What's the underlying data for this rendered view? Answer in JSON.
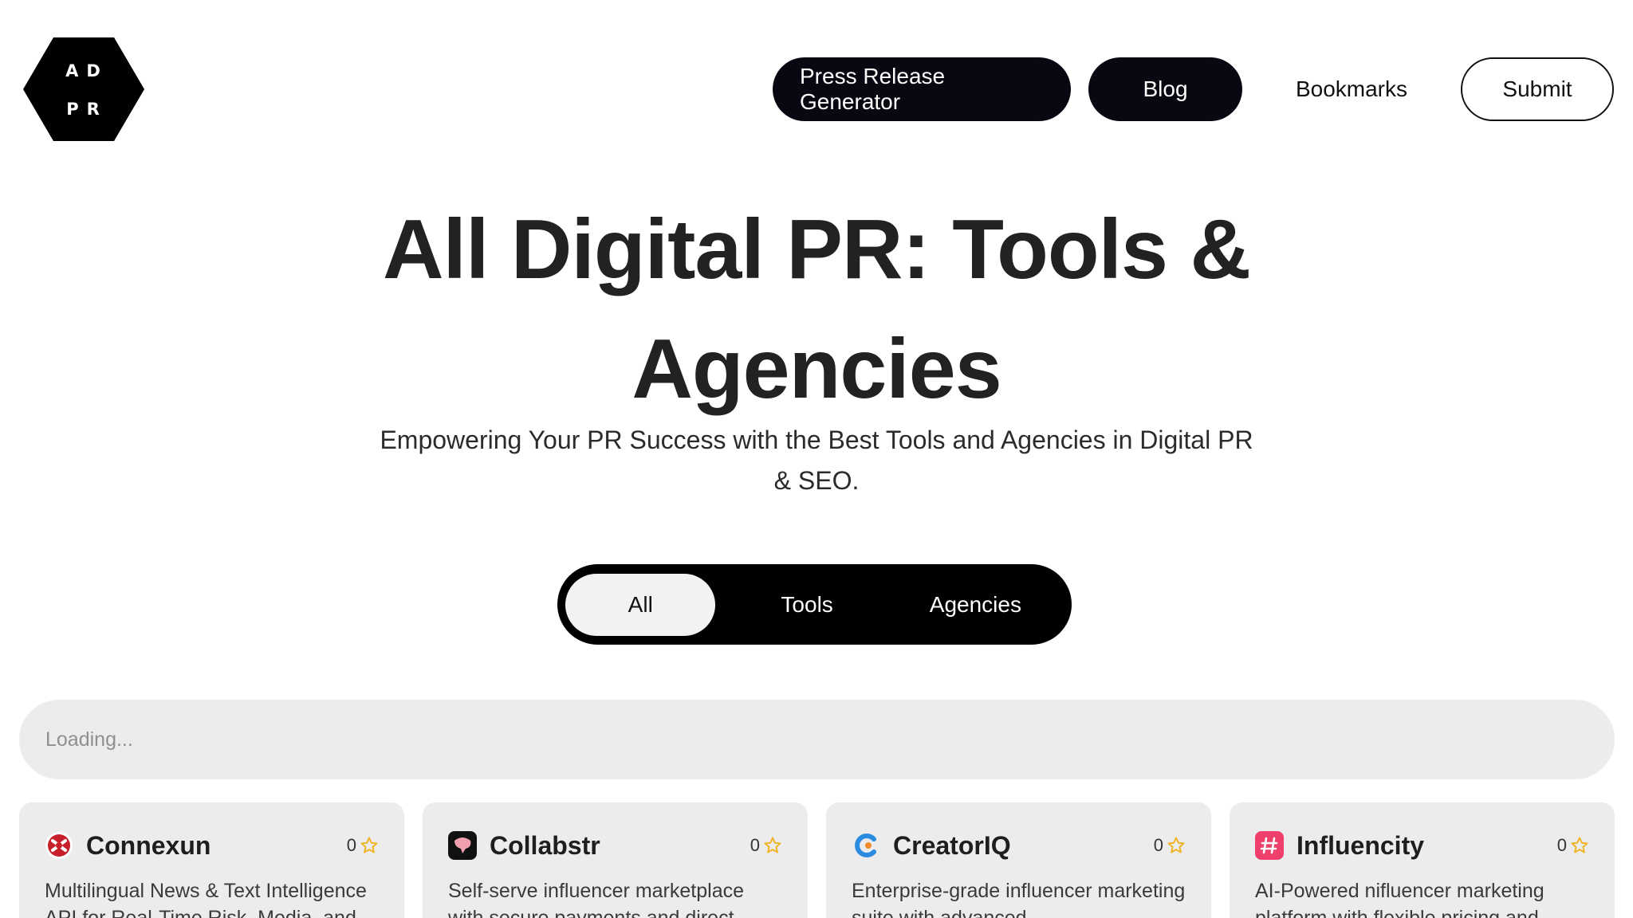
{
  "logo": {
    "line1": "AD",
    "line2": "PR"
  },
  "nav": {
    "press_release": "Press Release Generator",
    "blog": "Blog",
    "bookmarks": "Bookmarks",
    "submit": "Submit"
  },
  "hero": {
    "title": "All Digital PR: Tools & Agencies",
    "subtitle": "Empowering Your PR Success with the Best Tools and Agencies in Digital PR & SEO."
  },
  "filter": {
    "options": [
      "All",
      "Tools",
      "Agencies"
    ],
    "selected": "All"
  },
  "search": {
    "placeholder": "Loading..."
  },
  "cards": [
    {
      "name": "Connexun",
      "rating": "0",
      "icon": "connexun-logo-icon",
      "description": "Multilingual News & Text Intelligence API for Real-Time Risk, Media, and"
    },
    {
      "name": "Collabstr",
      "rating": "0",
      "icon": "collabstr-logo-icon",
      "description": "Self-serve influencer marketplace with secure payments and direct"
    },
    {
      "name": "CreatorIQ",
      "rating": "0",
      "icon": "creatoriq-logo-icon",
      "description": "Enterprise-grade influencer marketing suite with advanced"
    },
    {
      "name": "Influencity",
      "rating": "0",
      "icon": "influencity-logo-icon",
      "description": "AI-Powered nifluencer marketing platform with flexible pricing and"
    }
  ],
  "colors": {
    "accent_dark": "#080812",
    "card_bg": "#ececec",
    "star": "#f0b429"
  }
}
